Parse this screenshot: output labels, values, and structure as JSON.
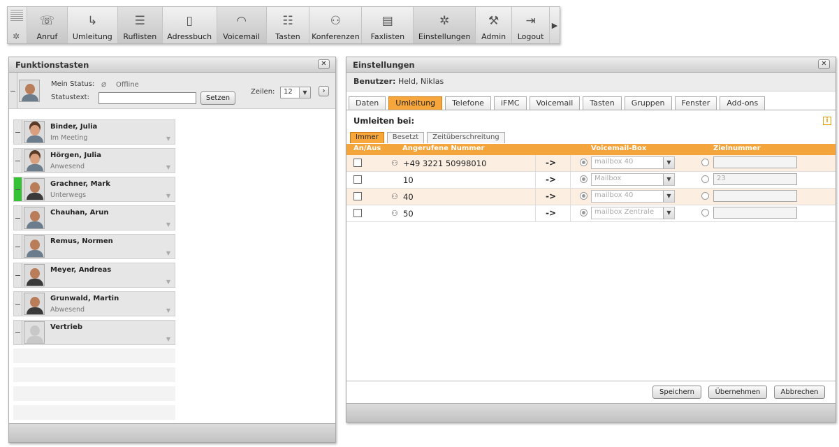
{
  "toolbar": {
    "items": [
      {
        "label": "Anruf",
        "icon": "phone-icon",
        "glyph": "☏"
      },
      {
        "label": "Umleitung",
        "icon": "forward-arrow-icon",
        "glyph": "↳"
      },
      {
        "label": "Ruflisten",
        "icon": "list-icon",
        "glyph": "☰"
      },
      {
        "label": "Adressbuch",
        "icon": "address-book-icon",
        "glyph": "▯"
      },
      {
        "label": "Voicemail",
        "icon": "voicemail-icon",
        "glyph": "◠"
      },
      {
        "label": "Tasten",
        "icon": "keys-list-icon",
        "glyph": "☷"
      },
      {
        "label": "Konferenzen",
        "icon": "conference-icon",
        "glyph": "⚇"
      },
      {
        "label": "Faxlisten",
        "icon": "fax-icon",
        "glyph": "▤"
      },
      {
        "label": "Einstellungen",
        "icon": "settings-gear-icon",
        "glyph": "✲"
      },
      {
        "label": "Admin",
        "icon": "admin-tools-icon",
        "glyph": "⚒"
      },
      {
        "label": "Logout",
        "icon": "logout-door-icon",
        "glyph": "⇥"
      }
    ],
    "next_glyph": "▶"
  },
  "left": {
    "title": "Funktionstasten",
    "close": "✕",
    "my_status_label": "Mein Status:",
    "my_status_value": "Offline",
    "statustext_label": "Statustext:",
    "statustext_value": "",
    "set_button": "Setzen",
    "rows_label": "Zeilen:",
    "rows_value": "12",
    "next_button": "›",
    "contacts": [
      {
        "name": "Binder, Julia",
        "status": "Im Meeting"
      },
      {
        "name": "Hörgen, Julia",
        "status": "Anwesend"
      },
      {
        "name": "Grachner, Mark",
        "status": "Unterwegs"
      },
      {
        "name": "Chauhan, Arun",
        "status": ""
      },
      {
        "name": "Remus, Normen",
        "status": ""
      },
      {
        "name": "Meyer, Andreas",
        "status": ""
      },
      {
        "name": "Grunwald, Martin",
        "status": "Abwesend"
      },
      {
        "name": "Vertrieb",
        "status": ""
      }
    ]
  },
  "right": {
    "title": "Einstellungen",
    "close": "✕",
    "user_label": "Benutzer:",
    "user_value": "Held, Niklas",
    "tabs": [
      "Daten",
      "Umleitung",
      "Telefone",
      "iFMC",
      "Voicemail",
      "Tasten",
      "Gruppen",
      "Fenster",
      "Add-ons"
    ],
    "active_tab": "Umleitung",
    "section_title": "Umleiten bei:",
    "info_glyph": "i",
    "sub_tabs": [
      "Immer",
      "Besetzt",
      "Zeitüberschreitung"
    ],
    "columns": [
      "An/Aus",
      "Angerufene Nummer",
      "Voicemail-Box",
      "Zielnummer"
    ],
    "rows": [
      {
        "number": "+49 3221 50998010",
        "arrow": "->",
        "mailbox": "mailbox 40",
        "target": ""
      },
      {
        "number": "10",
        "arrow": "->",
        "mailbox": "Mailbox",
        "target": "23"
      },
      {
        "number": "40",
        "arrow": "->",
        "mailbox": "mailbox 40",
        "target": ""
      },
      {
        "number": "50",
        "arrow": "->",
        "mailbox": "mailbox Zentrale",
        "target": ""
      }
    ],
    "buttons": {
      "save": "Speichern",
      "apply": "Übernehmen",
      "cancel": "Abbrechen"
    }
  },
  "colors": {
    "accent": "#f6a63b",
    "online_green": "#35c335",
    "table_header": "#f3a43a"
  }
}
